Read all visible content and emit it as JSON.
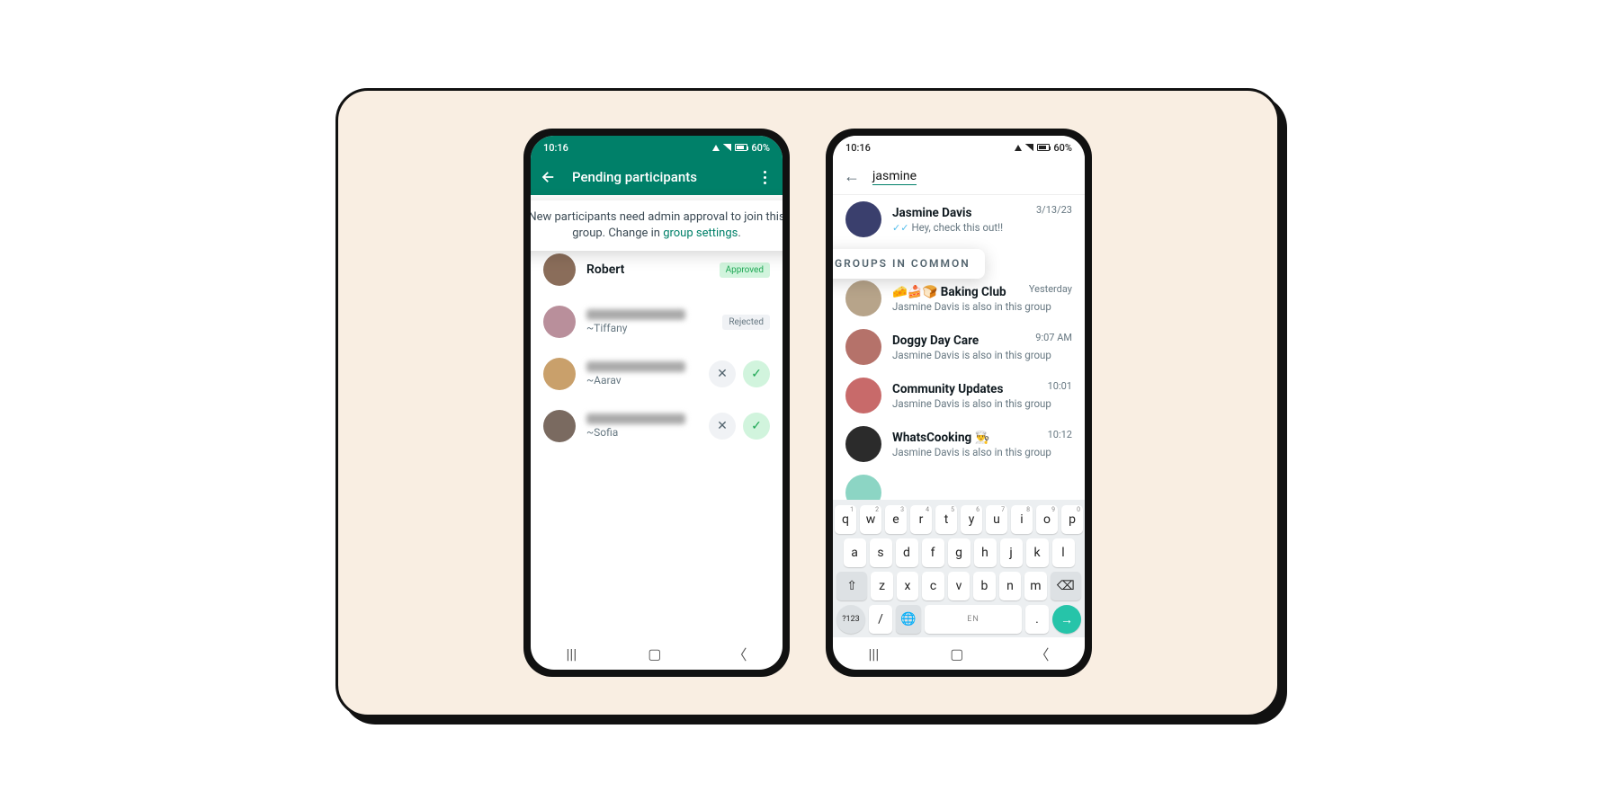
{
  "phone1": {
    "status": {
      "time": "10:16",
      "battery": "60%"
    },
    "appbar": {
      "title": "Pending participants"
    },
    "tooltip": {
      "text": "New participants need admin approval to join this group. Change in ",
      "link": "group settings",
      "period": "."
    },
    "pending": [
      {
        "name": "Robert",
        "sub": "",
        "status": "Approved",
        "avatarColor": "#8a6d5a"
      },
      {
        "name": "~Tiffany",
        "sub": "~Tiffany",
        "status": "Rejected",
        "avatarColor": "#b98f9b"
      },
      {
        "name": "~Aarav",
        "sub": "~Aarav",
        "status": "pending",
        "avatarColor": "#c9a06b"
      },
      {
        "name": "~Sofia",
        "sub": "~Sofia",
        "status": "pending",
        "avatarColor": "#7a6a60"
      }
    ]
  },
  "phone2": {
    "status": {
      "time": "10:16",
      "battery": "60%"
    },
    "search": {
      "query": "jasmine"
    },
    "tooltip": {
      "label": "GROUPS IN COMMON"
    },
    "topResult": {
      "name": "Jasmine Davis",
      "preview": "Hey, check this out!!",
      "time": "3/13/23",
      "avatarColor": "#3a3f6d"
    },
    "groups": [
      {
        "name": "🧀🍰🍞 Baking Club",
        "sub": "Jasmine Davis is also in this group",
        "time": "Yesterday",
        "avatarColor": "#b7a48a"
      },
      {
        "name": "Doggy Day Care",
        "sub": "Jasmine Davis is also in this group",
        "time": "9:07 AM",
        "avatarColor": "#b5726a"
      },
      {
        "name": "Community Updates",
        "sub": "Jasmine Davis is also in this group",
        "time": "10:01",
        "avatarColor": "#c86a6a"
      },
      {
        "name": "WhatsCooking 👨‍🍳",
        "sub": "Jasmine Davis is also in this group",
        "time": "10:12",
        "avatarColor": "#2b2b2b"
      }
    ],
    "keyboard": {
      "row1": [
        "q",
        "w",
        "e",
        "r",
        "t",
        "y",
        "u",
        "i",
        "o",
        "p"
      ],
      "nums": [
        "1",
        "2",
        "3",
        "4",
        "5",
        "6",
        "7",
        "8",
        "9",
        "0"
      ],
      "row2": [
        "a",
        "s",
        "d",
        "f",
        "g",
        "h",
        "j",
        "k",
        "l"
      ],
      "row3": [
        "z",
        "x",
        "c",
        "v",
        "b",
        "n",
        "m"
      ],
      "bottom": {
        "sym": "?123",
        "slash": "/",
        "lang": "EN",
        "dot": "."
      }
    }
  }
}
